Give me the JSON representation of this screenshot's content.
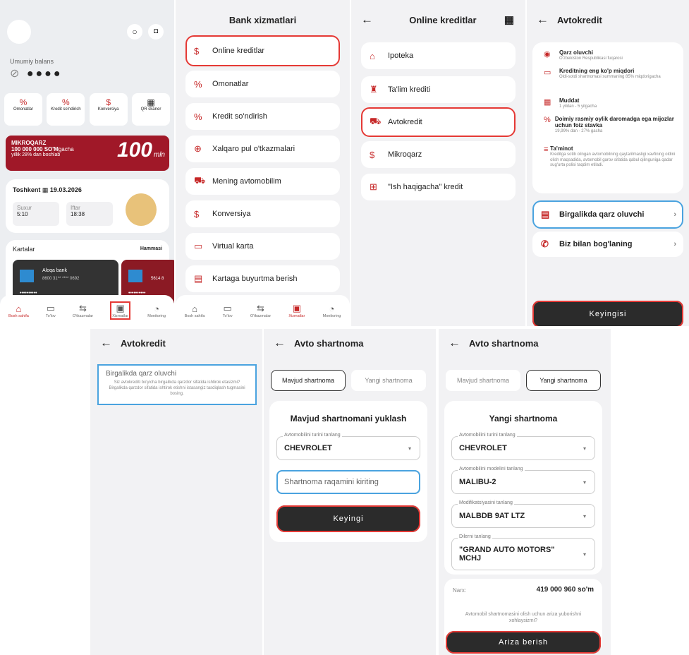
{
  "home": {
    "balance_label": "Umumiy balans",
    "quick": [
      "Omonatlar",
      "Kredit so'ndirish",
      "Konversiya",
      "QR skaner"
    ],
    "banner": {
      "title": "MIKROQARZ",
      "amount": "100 000 000 SO'M",
      "suffix": "gacha",
      "sub": "yillik 28% dan boshlab",
      "big": "100",
      "big_sub": "mln"
    },
    "city": "Toshkent",
    "date": "19.03.2026",
    "suhur_label": "Suxur",
    "suhur_time": "5:10",
    "iftar_label": "Iftar",
    "iftar_time": "18:38",
    "cards_title": "Kartalar",
    "cards_all": "Hammasi",
    "card1_bank": "Aloqa bank",
    "card1_num": "8600 31** **** 0692",
    "card1_mask": "••••••••••",
    "card2_num": "5614 8",
    "card2_mask": "••••••••••"
  },
  "tabs": [
    "Bosh sahifa",
    "To'lov",
    "O'tkazmalar",
    "Xizmatlar",
    "Monitoring"
  ],
  "services": {
    "title": "Bank xizmatlari",
    "items": [
      "Online kreditlar",
      "Omonatlar",
      "Kredit so'ndirish",
      "Xalqaro pul o'tkazmalari",
      "Mening avtomobilim",
      "Konversiya",
      "Virtual karta",
      "Kartaga buyurtma berish"
    ]
  },
  "online": {
    "title": "Online kreditlar",
    "items": [
      "Ipoteka",
      "Ta'lim krediti",
      "Avtokredit",
      "Mikroqarz",
      "\"Ish haqigacha\" kredit"
    ]
  },
  "avto": {
    "title": "Avtokredit",
    "info": [
      {
        "t": "Qarz oluvchi",
        "s": "O'zbekiston Respublikasi fuqarosi"
      },
      {
        "t": "Kreditning eng ko'p miqdori",
        "s": "Oldi-sotdi shartnomasi summaning 85% miqdorigacha"
      },
      {
        "t": "Muddat",
        "s": "1 yildan - 5 yilgacha"
      },
      {
        "t": "Doimiy rasmiy oylik daromadga ega mijozlar uchun foiz stavka",
        "s": "19,99% dan - 27% gacha"
      },
      {
        "t": "Ta'minot",
        "s": "Kreditga sotib olingan avtomobilning qaytarilmasligi xavfining oldini olish maqsadida, avtomobil garov sifatida qabul qilinguniga qadar sug'urta polisi taqdim etiladi."
      }
    ],
    "co_borrower": "Birgalikda qarz oluvchi",
    "contact": "Biz bilan bog'laning",
    "next": "Keyingisi"
  },
  "co": {
    "title": "Avtokredit",
    "box_title": "Birgalikda qarz oluvchi",
    "box_text": "Siz avtokrediti bo'yicha birgalikda qarzdor sifatida ishtirok etasizmi? Birgalikda qarzdor sifatida ishtirok etishni istasangiz tasdiqlash tugmasini bosing."
  },
  "contract1": {
    "title": "Avto shartnoma",
    "seg_a": "Mavjud shartnoma",
    "seg_b": "Yangi shartnoma",
    "heading": "Mavjud shartnomani yuklash",
    "car_label": "Avtomobilini turini tanlang",
    "car_value": "CHEVROLET",
    "placeholder": "Shartnoma raqamini kiriting",
    "next": "Keyingi"
  },
  "contract2": {
    "title": "Avto shartnoma",
    "seg_a": "Mavjud shartnoma",
    "seg_b": "Yangi shartnoma",
    "heading": "Yangi shartnoma",
    "f1_label": "Avtomobilini turini tanlang",
    "f1_value": "CHEVROLET",
    "f2_label": "Avtomobilini modelini tanlang",
    "f2_value": "MALIBU-2",
    "f3_label": "Modifikatsiyasini tanlang",
    "f3_value": "MALBDB 9AT LTZ",
    "f4_label": "Dilerni tanlang",
    "f4_value": "\"GRAND AUTO MOTORS\" MCHJ",
    "price_label": "Narx:",
    "price_value": "419 000 960 so'm",
    "question": "Avtomobil shartnomasini olish uchun ariza yuborishni xohlaysizmi?",
    "submit": "Ariza berish"
  }
}
